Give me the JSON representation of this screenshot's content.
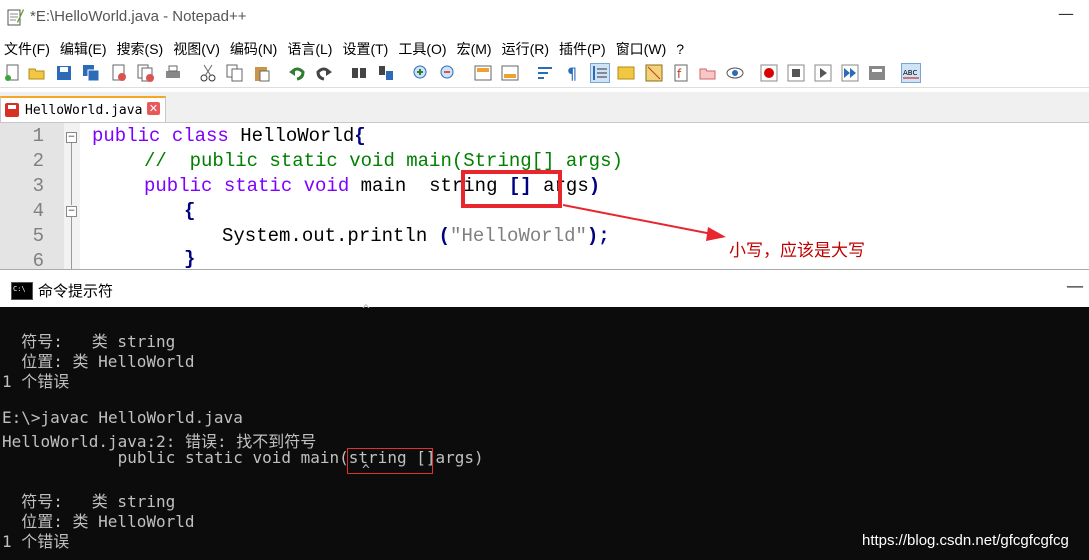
{
  "notepad": {
    "title": "*E:\\HelloWorld.java - Notepad++",
    "min_symbol": "—",
    "menu": [
      "文件(F)",
      "编辑(E)",
      "搜索(S)",
      "视图(V)",
      "编码(N)",
      "语言(L)",
      "设置(T)",
      "工具(O)",
      "宏(M)",
      "运行(R)",
      "插件(P)",
      "窗口(W)",
      "?"
    ],
    "tab": {
      "label": "HelloWorld.java",
      "close": "✕"
    },
    "line_numbers": [
      "1",
      "2",
      "3",
      "4",
      "5",
      "6"
    ],
    "code": {
      "l1_kw": "public class ",
      "l1_rest": "HelloWorld",
      "l1_brace": "{",
      "l2_comment": "//  public static void main(String[] args)",
      "l3_kw": "public static void ",
      "l3_main": "main  ",
      "l3_string": "string ",
      "l3_bracket": "[] ",
      "l3_args": "args",
      "l3_paren": ")",
      "l4_brace": "{",
      "l5_obj": "System.out.println ",
      "l5_open": "(",
      "l5_str": "\"HelloWorld\"",
      "l5_close": ");",
      "l6_brace": "}"
    },
    "annotation": "小写，应该是大写",
    "annotation_color": "#c00000"
  },
  "cmd": {
    "title": "命令提示符",
    "min_symbol": "—",
    "lines": [
      "  符号:   类 string",
      "  位置: 类 HelloWorld",
      "1 个错误",
      "",
      "E:\\>javac HelloWorld.java",
      "HelloWorld.java:2: 错误: 找不到符号",
      "            public static void main(string []args)",
      "",
      "  符号:   类 string",
      "  位置: 类 HelloWorld",
      "1 个错误"
    ],
    "caret_symbol": "^"
  },
  "watermark": "https://blog.csdn.net/gfcgfcgfcg"
}
